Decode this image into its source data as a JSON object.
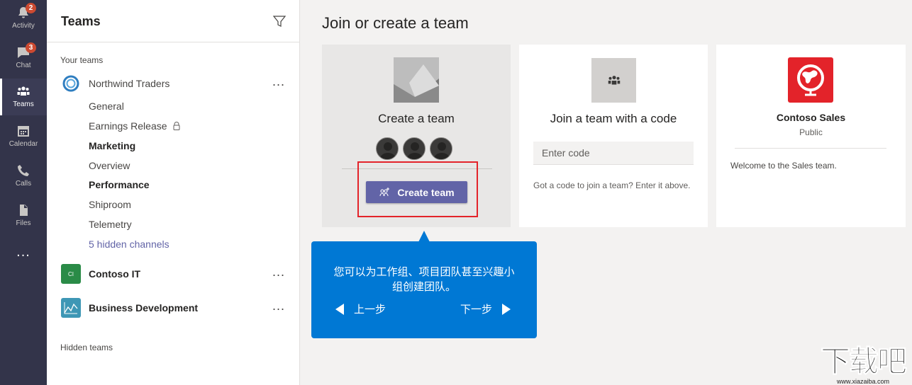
{
  "rail": {
    "items": [
      {
        "label": "Activity",
        "badge": "2"
      },
      {
        "label": "Chat",
        "badge": "3"
      },
      {
        "label": "Teams"
      },
      {
        "label": "Calendar"
      },
      {
        "label": "Calls"
      },
      {
        "label": "Files"
      }
    ],
    "more": "..."
  },
  "panel": {
    "title": "Teams",
    "your_teams_label": "Your teams",
    "hidden_teams_label": "Hidden teams",
    "teams": [
      {
        "name": "Northwind Traders",
        "more": "...",
        "channels": [
          {
            "name": "General"
          },
          {
            "name": "Earnings Release",
            "locked": true
          },
          {
            "name": "Marketing",
            "bold": true
          },
          {
            "name": "Overview"
          },
          {
            "name": "Performance",
            "bold": true
          },
          {
            "name": "Shiproom"
          },
          {
            "name": "Telemetry"
          },
          {
            "name": "5 hidden channels",
            "link": true
          }
        ]
      },
      {
        "name": "Contoso IT",
        "avatar": "CI",
        "avatar_color": "#2a8b47",
        "more": "..."
      },
      {
        "name": "Business Development",
        "avatar_color": "#3e97b5",
        "more": "..."
      }
    ]
  },
  "main": {
    "title": "Join or create a team",
    "create_card": {
      "title": "Create a team",
      "button": "Create team"
    },
    "join_card": {
      "title": "Join a team with a code",
      "placeholder": "Enter code",
      "hint": "Got a code to join a team? Enter it above."
    },
    "team_card": {
      "name": "Contoso Sales",
      "type": "Public",
      "description": "Welcome to the Sales team."
    }
  },
  "tooltip": {
    "text": "您可以为工作组、项目团队甚至兴趣小组创建团队。",
    "prev": "上一步",
    "next": "下一步"
  },
  "watermark": {
    "text": "下载吧",
    "url": "www.xiazaiba.com"
  },
  "colors": {
    "rail": "#33344a",
    "accent": "#6264a7",
    "tooltip": "#0078d4",
    "highlight": "#e3232a"
  }
}
